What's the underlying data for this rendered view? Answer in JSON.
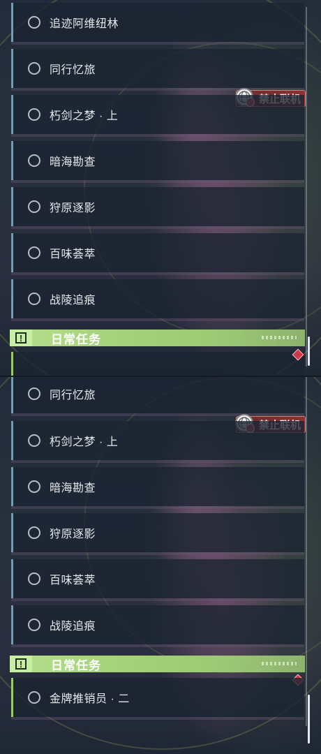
{
  "top": {
    "quests": [
      {
        "label": "追迹阿维纽林"
      },
      {
        "label": "同行忆旅"
      },
      {
        "label": "朽剑之梦 · 上"
      },
      {
        "label": "暗海勘查"
      },
      {
        "label": "狩原逐影"
      },
      {
        "label": "百味荟萃"
      },
      {
        "label": "战陵追痕"
      }
    ],
    "online_badge": "禁止联机",
    "daily_header": "日常任务"
  },
  "bottom": {
    "quests": [
      {
        "label": "同行忆旅"
      },
      {
        "label": "朽剑之梦 · 上"
      },
      {
        "label": "暗海勘查"
      },
      {
        "label": "狩原逐影"
      },
      {
        "label": "百味荟萃"
      },
      {
        "label": "战陵追痕"
      }
    ],
    "online_badge": "禁止联机",
    "daily_header": "日常任务",
    "daily_quests": [
      {
        "label": "金牌推销员 · 二"
      }
    ]
  },
  "icons": {
    "quest_status": "empty-circle-icon",
    "no_online": "globe-no-entry-icon",
    "daily_alert": "exclamation-icon",
    "tracking_marker": "red-diamond-icon"
  },
  "colors": {
    "daily_accent": "#a7d47c",
    "badge_red": "#9a3a3a",
    "item_border": "#7a9ab0"
  }
}
